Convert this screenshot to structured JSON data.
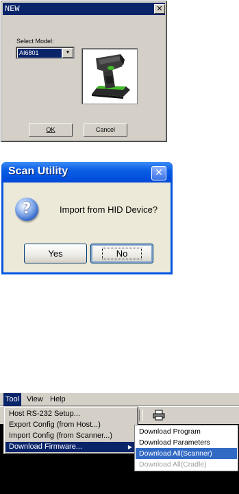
{
  "dialog_new": {
    "title": "NEW",
    "close_label": "✕",
    "select_model_label": "Select Model:",
    "select_model_value": "AI6801",
    "ok_button": "OK",
    "cancel_button": "Cancel",
    "image": "barcode-scanner-in-cradle"
  },
  "dialog_scan": {
    "title": "Scan Utility",
    "close_label": "✕",
    "icon": "question-icon",
    "message": "Import from HID Device?",
    "yes_button": "Yes",
    "no_button": "No"
  },
  "menu_panel": {
    "menubar": [
      "Tool",
      "View",
      "Help"
    ],
    "active_menu": "Tool",
    "tool_menu_items": [
      "Host RS-232 Setup...",
      "Export Config (from Host...)",
      "Import Config (from Scanner...)",
      "Download Firmware..."
    ],
    "highlighted_item": "Download Firmware...",
    "submenu_items": [
      "Download Program",
      "Download Parameters",
      "Download All(Scanner)",
      "Download All(Cradle)"
    ],
    "submenu_highlighted": "Download All(Scanner)",
    "submenu_disabled": "Download All(Cradle)",
    "toolbar_icon": "printer-icon"
  },
  "colors": {
    "classic_title": "#0a246a",
    "xp_title": "#0054e3",
    "highlight": "#316ac5",
    "dialog_bg": "#d4d0c8",
    "xp_body": "#ece9d8"
  }
}
